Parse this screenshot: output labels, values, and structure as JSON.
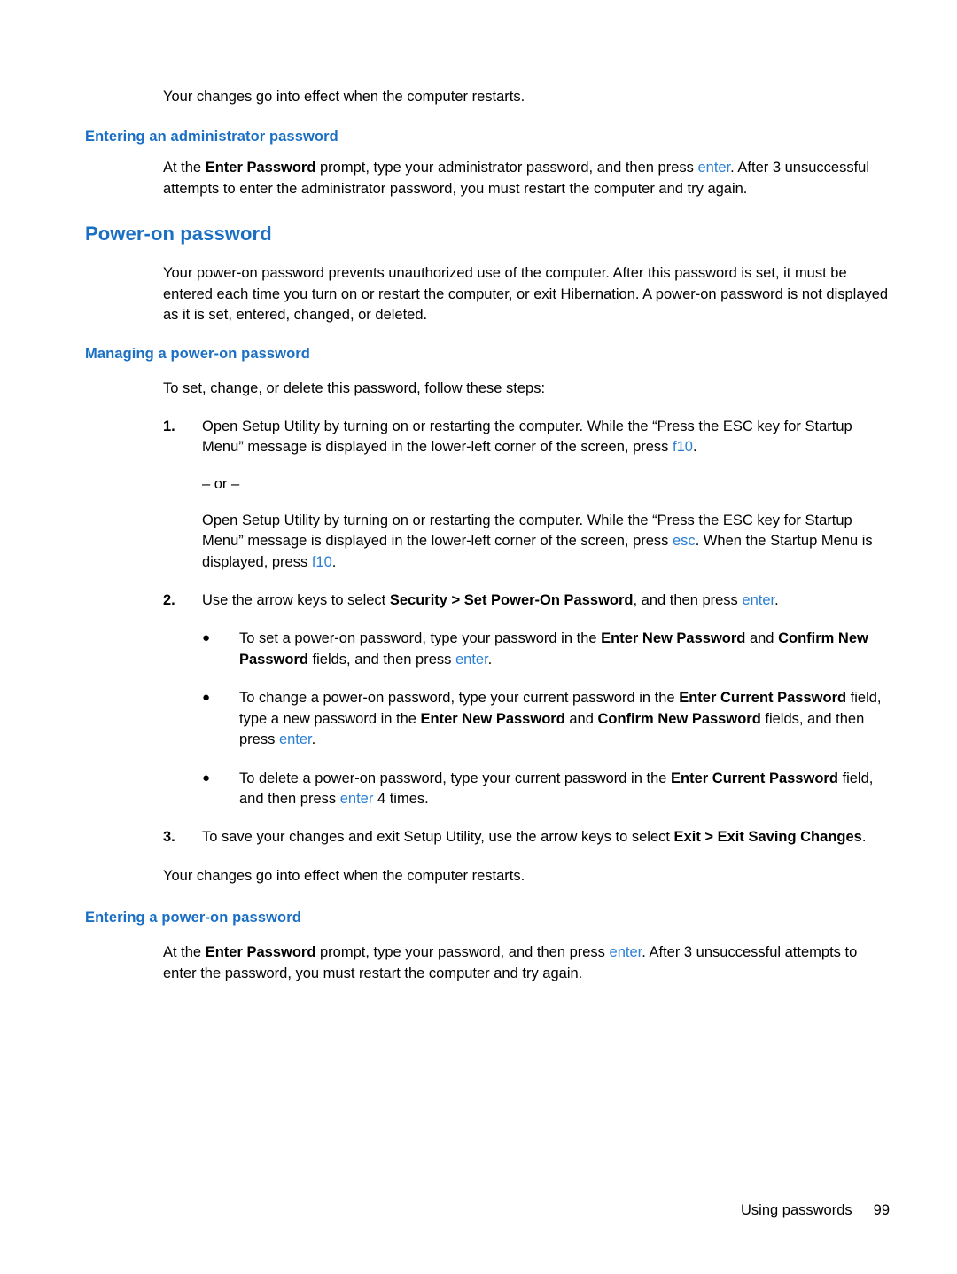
{
  "doc": {
    "intro_line": "Your changes go into effect when the computer restarts.",
    "section_admin": {
      "heading": "Entering an administrator password",
      "para_a": "At the ",
      "para_b": "Enter Password",
      "para_c": " prompt, type your administrator password, and then press ",
      "key_enter": "enter",
      "para_d": ". After 3 unsuccessful attempts to enter the administrator password, you must restart the computer and try again."
    },
    "section_power_on": {
      "heading": "Power-on password",
      "para": "Your power-on password prevents unauthorized use of the computer. After this password is set, it must be entered each time you turn on or restart the computer, or exit Hibernation. A power-on password is not displayed as it is set, entered, changed, or deleted."
    },
    "section_managing": {
      "heading": "Managing a power-on password",
      "lead": "To set, change, or delete this password, follow these steps:",
      "step1": {
        "number": "1.",
        "text_a": "Open Setup Utility by turning on or restarting the computer. While the “Press the ESC key for Startup Menu” message is displayed in the lower-left corner of the screen, press ",
        "key": "f10",
        "text_b": "."
      },
      "or_label": "– or –",
      "alt_step": {
        "text_a": "Open Setup Utility by turning on or restarting the computer. While the “Press the ESC key for Startup Menu” message is displayed in the lower-left corner of the screen, press ",
        "key_esc": "esc",
        "text_b": ". When the Startup Menu is displayed, press ",
        "key_f10": "f10",
        "text_c": "."
      },
      "step2": {
        "number": "2.",
        "text_a": "Use the arrow keys to select ",
        "bold_path": "Security > Set Power-On Password",
        "text_b": ", and then press ",
        "key_enter": "enter",
        "text_c": "."
      },
      "bullets": [
        {
          "text_a": "To set a power-on password, type your password in the ",
          "bold_1": "Enter New Password",
          "text_b": " and ",
          "bold_2": "Confirm New Password",
          "text_c": " fields, and then press ",
          "key": "enter",
          "text_d": "."
        },
        {
          "text_a": "To change a power-on password, type your current password in the ",
          "bold_1": "Enter Current Password",
          "text_b": " field, type a new password in the ",
          "bold_2": "Enter New Password",
          "text_c": " and ",
          "bold_3": "Confirm New Password",
          "text_d": " fields, and then press ",
          "key": "enter",
          "text_e": "."
        },
        {
          "text_a": "To delete a power-on password, type your current password in the ",
          "bold_1": "Enter Current Password",
          "text_b": " field, and then press ",
          "key": "enter",
          "text_c": " 4 times."
        }
      ],
      "step3": {
        "number": "3.",
        "text_a": "To save your changes and exit Setup Utility, use the arrow keys to select ",
        "bold_path": "Exit > Exit Saving Changes",
        "text_b": "."
      },
      "closing": "Your changes go into effect when the computer restarts."
    },
    "section_entering_power_on": {
      "heading": "Entering a power-on password",
      "text_a": "At the ",
      "bold_1": "Enter Password",
      "text_b": " prompt, type your password, and then press ",
      "key": "enter",
      "text_c": ". After 3 unsuccessful attempts to enter the password, you must restart the computer and try again."
    },
    "footer": {
      "label": "Using passwords",
      "page_number": "99"
    },
    "colors": {
      "heading_blue": "#1a6fc4",
      "key_blue": "#2a7fd4",
      "text": "#000000"
    }
  }
}
